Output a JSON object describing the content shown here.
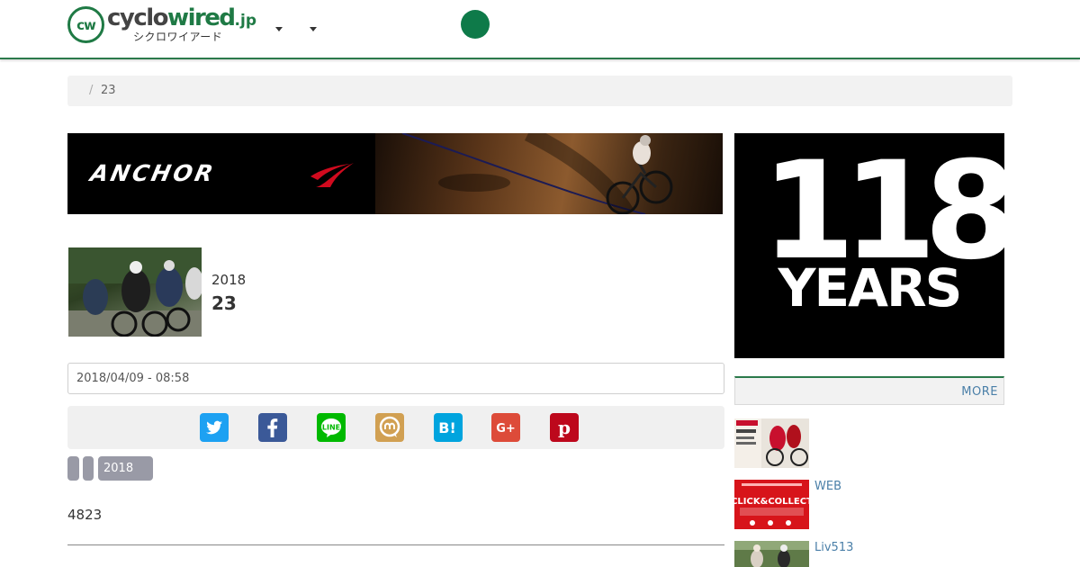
{
  "header": {
    "logo_mark": "cw",
    "logo_word_a": "cyclo",
    "logo_word_b": "wired",
    "logo_word_c": ".jp",
    "logo_kana": "シクロワイアード",
    "accent_color": "#0e7a49",
    "icons": [
      "caret-down-icon",
      "caret-down-icon"
    ]
  },
  "breadcrumb": {
    "separator": "/",
    "current": "23"
  },
  "ad_banner_main": {
    "brand": "ANCHOR"
  },
  "article": {
    "year": "2018",
    "title": "23",
    "date": "2018/04/09 - 08:58",
    "body_text": "4823"
  },
  "share": {
    "buttons": [
      {
        "name": "twitter",
        "color": "#1da1f2"
      },
      {
        "name": "facebook",
        "color": "#3b5998"
      },
      {
        "name": "line",
        "color": "#00b900"
      },
      {
        "name": "mixi",
        "color": "#d1a052"
      },
      {
        "name": "hatena",
        "color": "#00a4de"
      },
      {
        "name": "google-plus",
        "color": "#dd4b39"
      },
      {
        "name": "pinterest",
        "color": "#bd081c"
      }
    ]
  },
  "tags": [
    "",
    "",
    "2018"
  ],
  "sidebar": {
    "ad_number": "118",
    "ad_word": "YEARS",
    "more_label": "MORE",
    "items": [
      {
        "title": ""
      },
      {
        "title": "WEB"
      },
      {
        "title": "Liv513"
      }
    ]
  }
}
